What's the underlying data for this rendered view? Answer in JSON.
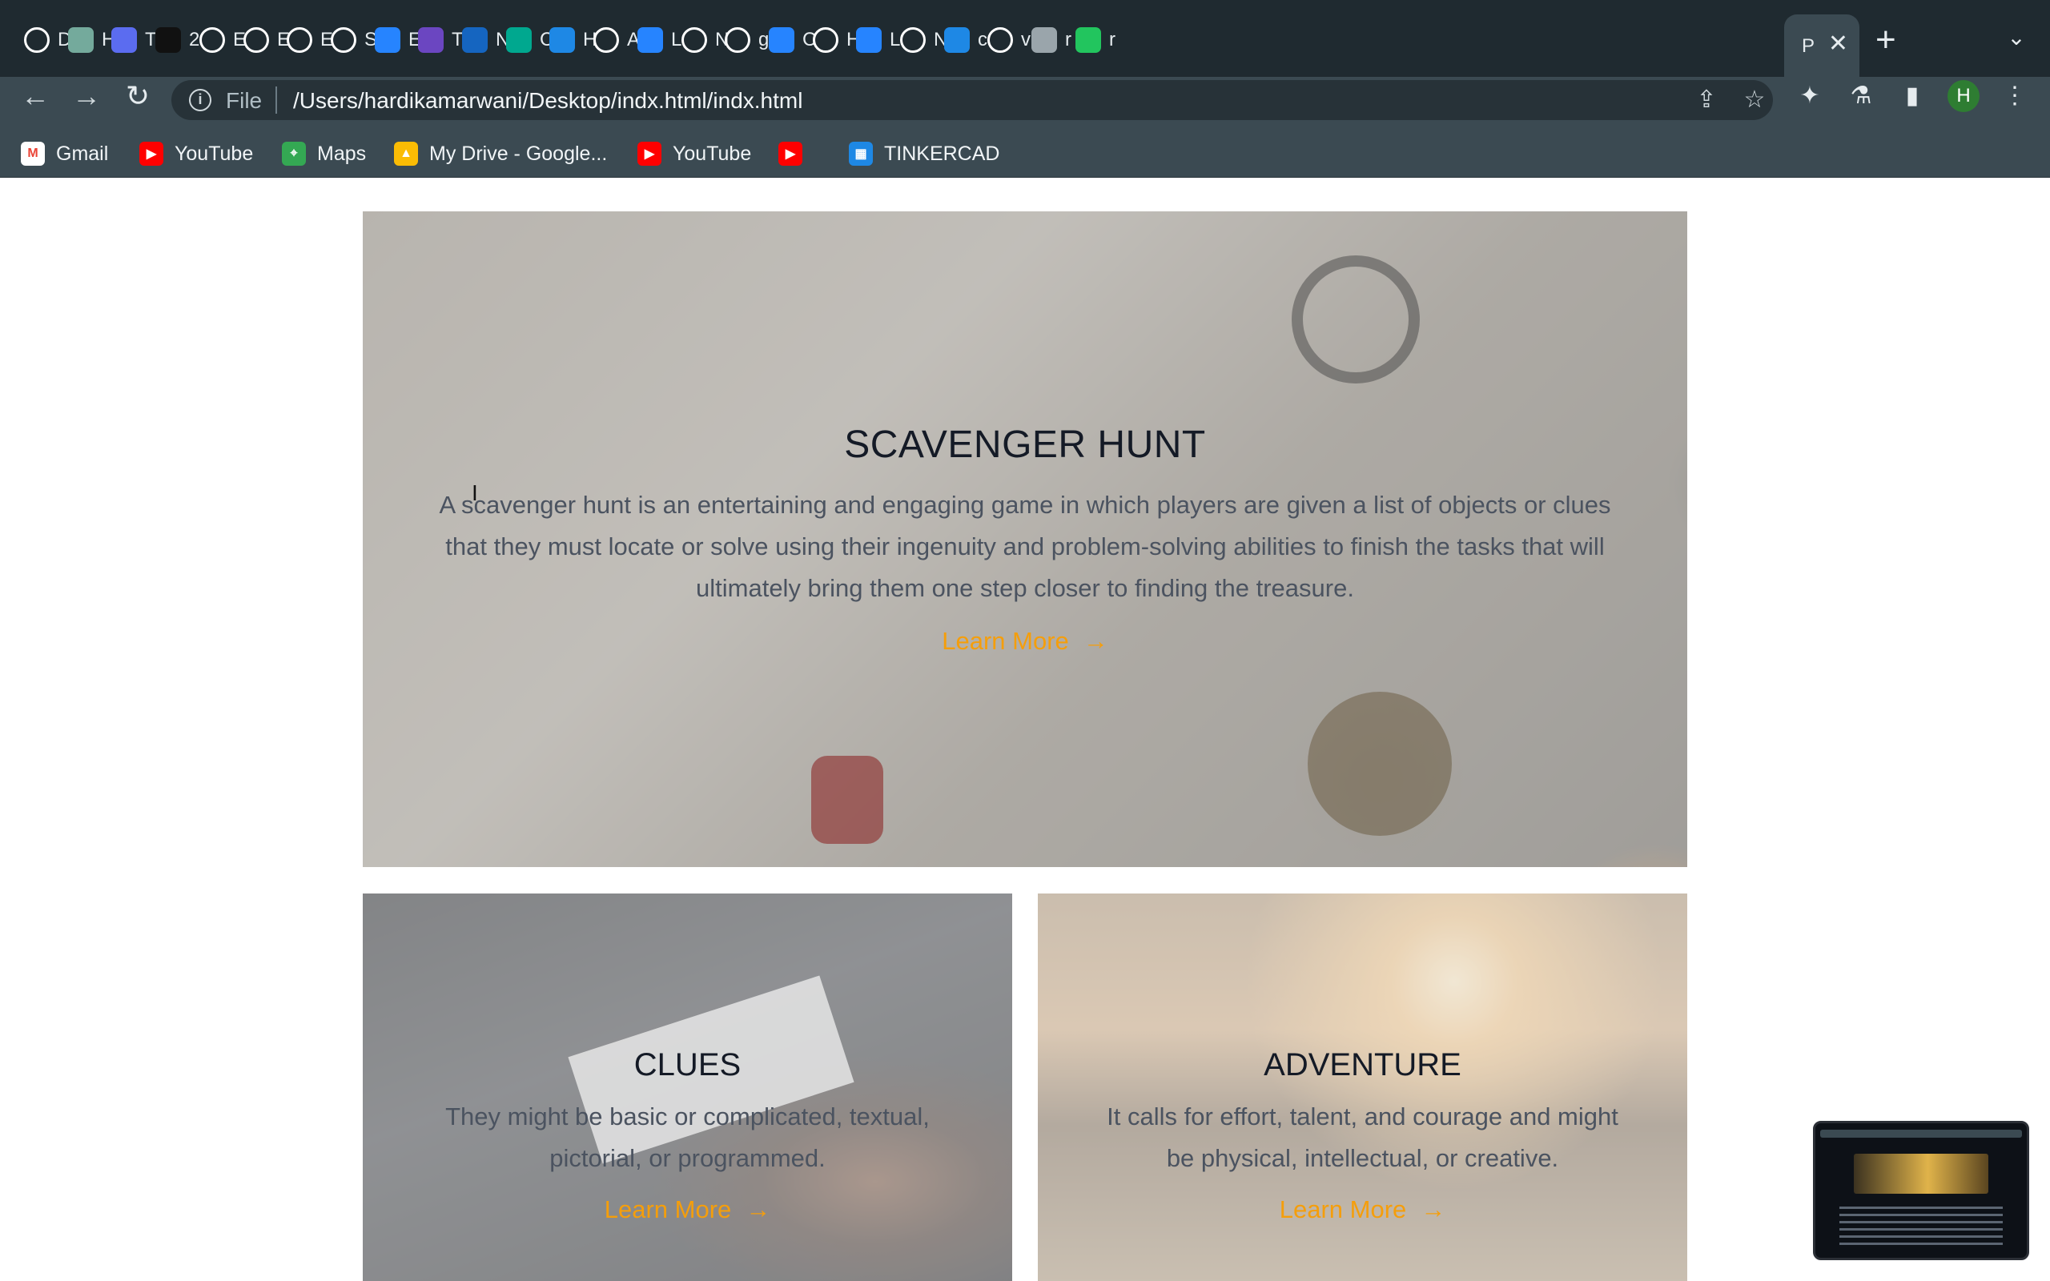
{
  "browser": {
    "tabs": [
      {
        "label": "D",
        "icon": "globe-icon",
        "color": "#ffffff"
      },
      {
        "label": "H",
        "icon": "chatgpt-icon",
        "color": "#74aa9c"
      },
      {
        "label": "T",
        "icon": "stack-icon",
        "color": "#5b6cf0"
      },
      {
        "label": "2",
        "icon": "dark-app-icon",
        "color": "#111111"
      },
      {
        "label": "E",
        "icon": "globe-icon",
        "color": "#ffffff"
      },
      {
        "label": "E",
        "icon": "globe-icon",
        "color": "#ffffff"
      },
      {
        "label": "E",
        "icon": "google-icon",
        "color": "#ffffff"
      },
      {
        "label": "S",
        "icon": "gmail-icon",
        "color": "#ffffff"
      },
      {
        "label": "E",
        "icon": "atlassian-icon",
        "color": "#2684ff"
      },
      {
        "label": "T",
        "icon": "list-icon",
        "color": "#6b46c1"
      },
      {
        "label": "N",
        "icon": "swirl-icon",
        "color": "#1565c0"
      },
      {
        "label": "C",
        "icon": "diamond-icon",
        "color": "#00a88f"
      },
      {
        "label": "H",
        "icon": "shield-icon",
        "color": "#1e88e5"
      },
      {
        "label": "A",
        "icon": "globe-icon",
        "color": "#ffffff"
      },
      {
        "label": "L",
        "icon": "atlassian-icon",
        "color": "#2684ff"
      },
      {
        "label": "N",
        "icon": "github-icon",
        "color": "#ffffff"
      },
      {
        "label": "g",
        "icon": "google-icon",
        "color": "#ffffff"
      },
      {
        "label": "C",
        "icon": "atlassian-icon",
        "color": "#2684ff"
      },
      {
        "label": "H",
        "icon": "google-icon",
        "color": "#ffffff"
      },
      {
        "label": "L",
        "icon": "atlassian-icon",
        "color": "#2684ff"
      },
      {
        "label": "N",
        "icon": "github-icon",
        "color": "#ffffff"
      },
      {
        "label": "c",
        "icon": "shield-icon",
        "color": "#1e88e5"
      },
      {
        "label": "v",
        "icon": "google-icon",
        "color": "#ffffff"
      },
      {
        "label": "r",
        "icon": "globe-icon",
        "color": "#9aa5ab"
      },
      {
        "label": "r",
        "icon": "hash-icon",
        "color": "#22c55e"
      }
    ],
    "active_tab": {
      "label": "P",
      "close": "✕"
    },
    "new_tab": "+",
    "tab_menu": "⌄",
    "back": "←",
    "forward": "→",
    "reload": "↻",
    "omnibox": {
      "info": "i",
      "scheme": "File",
      "url": "/Users/hardikamarwani/Desktop/indx.html/indx.html"
    },
    "profile_initial": "H",
    "bookmarks": [
      {
        "label": "Gmail",
        "icon": "gmail-icon"
      },
      {
        "label": "YouTube",
        "icon": "youtube-icon"
      },
      {
        "label": "Maps",
        "icon": "maps-icon"
      },
      {
        "label": "My Drive - Google...",
        "icon": "drive-icon"
      },
      {
        "label": "YouTube",
        "icon": "youtube-icon"
      },
      {
        "label": "",
        "icon": "youtube-icon"
      },
      {
        "label": "TINKERCAD",
        "icon": "tinkercad-icon"
      }
    ]
  },
  "page": {
    "hero": {
      "title": "SCAVENGER HUNT",
      "text": "A scavenger hunt is an entertaining and engaging game in which players are given a list of objects or clues that they must locate or solve using their ingenuity and problem-solving abilities to finish the tasks that will ultimately bring them one step closer to finding the treasure.",
      "link": "Learn More",
      "arrow": "→"
    },
    "cards": [
      {
        "title": "CLUES",
        "text": "They might be basic or complicated, textual, pictorial, or programmed.",
        "link": "Learn More",
        "arrow": "→"
      },
      {
        "title": "ADVENTURE",
        "text": "It calls for effort, talent, and courage and might be physical, intellectual, or creative.",
        "link": "Learn More",
        "arrow": "→"
      }
    ]
  },
  "colors": {
    "accent": "#f59e0b",
    "title": "#141a26",
    "body_text": "#4b5360",
    "chrome_bg": "#3b4a52"
  }
}
